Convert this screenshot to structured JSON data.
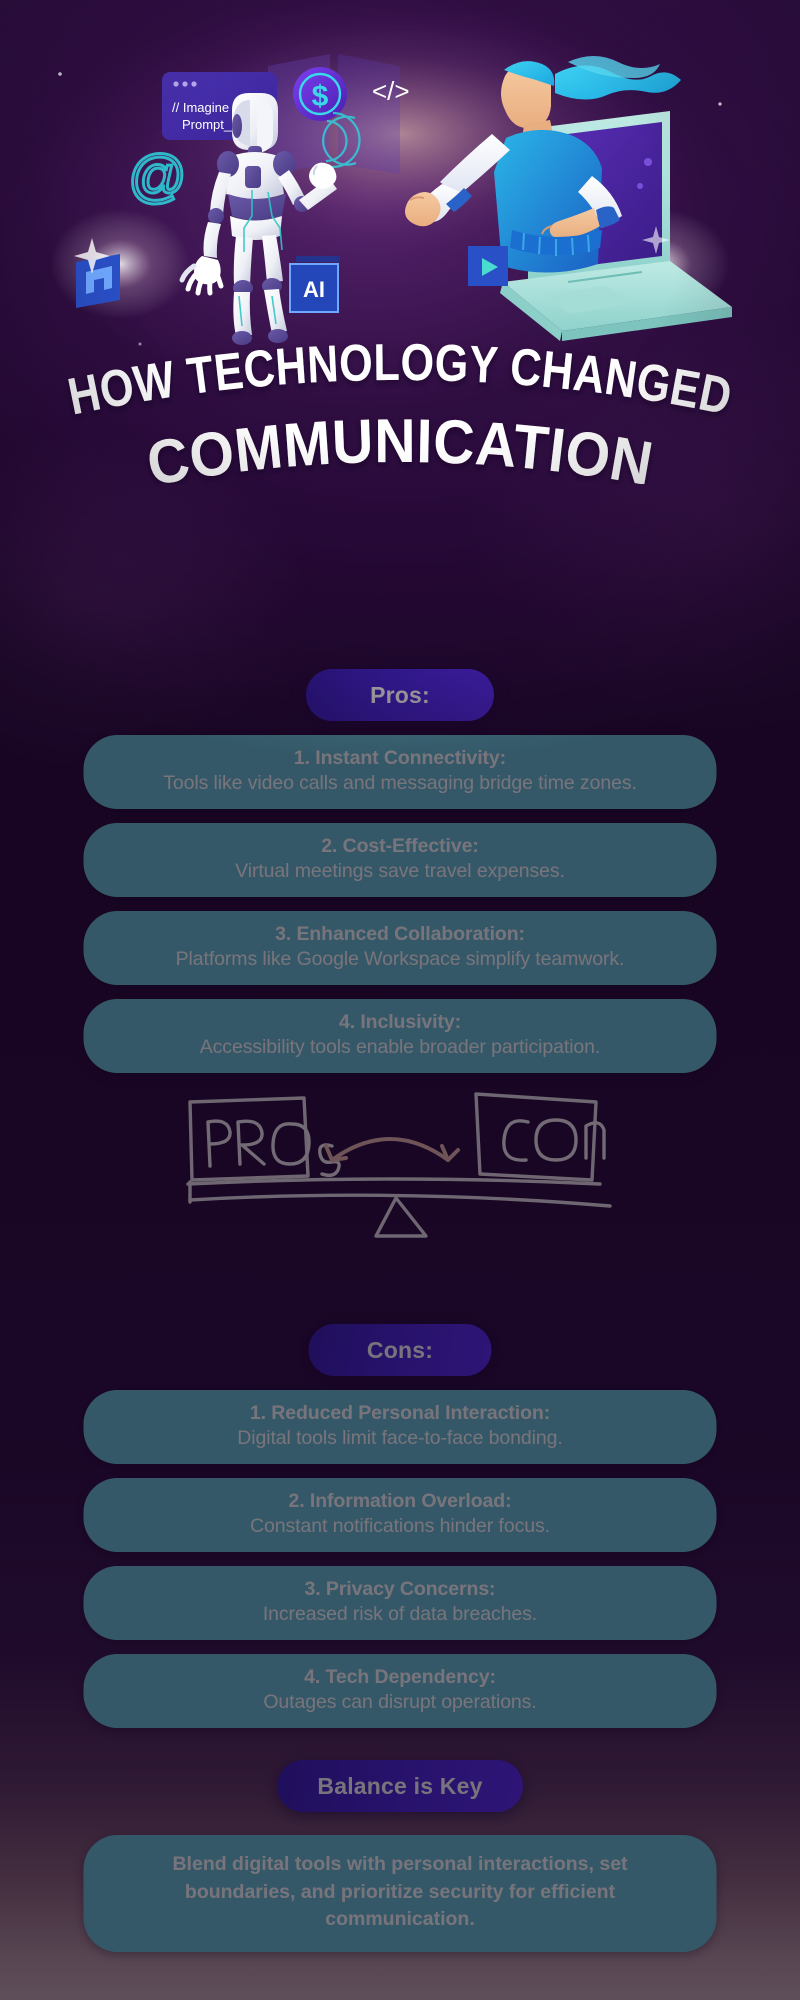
{
  "title": {
    "line1": "HOW TECHNOLOGY CHANGED",
    "line2": "COMMUNICATION"
  },
  "hero": {
    "alt": "robot and person fist bump through laptop",
    "prompt_window_line1": "// Imagine",
    "prompt_window_line2": "Prompt__",
    "code_icon": "</>",
    "at_icon": "@",
    "dollar_icon": "$",
    "ai_badge": "AI"
  },
  "pros": {
    "badge": "Pros:",
    "items": [
      {
        "title": "1. Instant Connectivity:",
        "desc": "Tools like video calls and messaging bridge time zones."
      },
      {
        "title": "2. Cost-Effective:",
        "desc": "Virtual meetings save travel expenses."
      },
      {
        "title": "3. Enhanced Collaboration:",
        "desc": "Platforms like Google Workspace simplify teamwork."
      },
      {
        "title": "4. Inclusivity:",
        "desc": "Accessibility tools enable broader participation."
      }
    ]
  },
  "scale": {
    "left_label": "PROs",
    "right_label": "CONs"
  },
  "cons": {
    "badge": "Cons:",
    "items": [
      {
        "title": "1. Reduced Personal Interaction:",
        "desc": "Digital tools limit face-to-face bonding."
      },
      {
        "title": "2. Information Overload:",
        "desc": "Constant notifications hinder focus."
      },
      {
        "title": "3. Privacy Concerns:",
        "desc": "Increased risk of data breaches."
      },
      {
        "title": "4. Tech Dependency:",
        "desc": "Outages can disrupt operations."
      }
    ]
  },
  "conclusion": {
    "badge": "Balance is Key",
    "text": "Blend digital tools with personal interactions, set boundaries, and prioritize security for efficient communication."
  },
  "colors": {
    "background_top": "#35104a",
    "background_bottom": "#c6adb4",
    "badge_purple": "#4a26d8",
    "card_teal": "#68c1d2",
    "text_white": "#ffffff"
  }
}
